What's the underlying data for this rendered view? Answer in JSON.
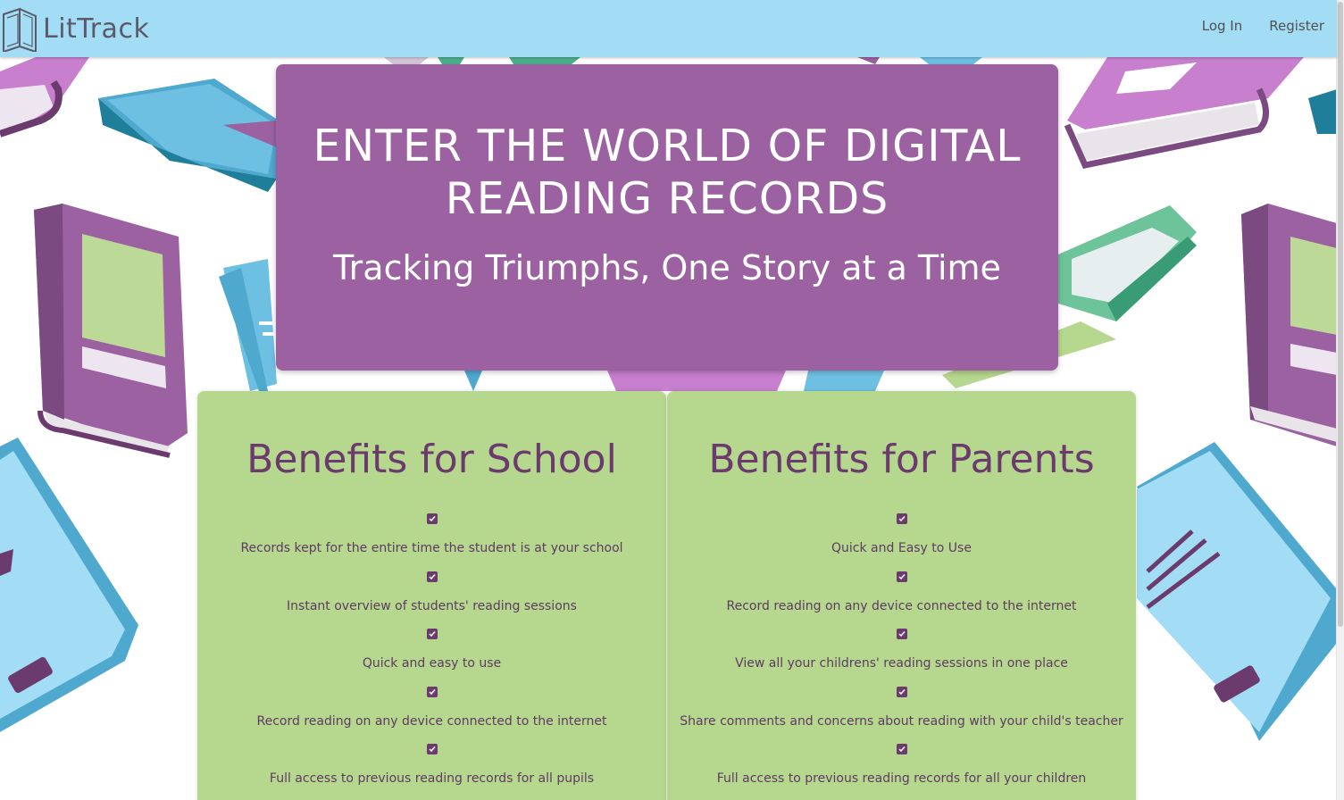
{
  "navbar": {
    "brand": "LitTrack",
    "brand_icon": "open-book-icon",
    "links": [
      {
        "label": "Log In"
      },
      {
        "label": "Register"
      }
    ],
    "background_color": "#a3dcf5"
  },
  "hero": {
    "title": "ENTER THE WORLD OF DIGITAL READING RECORDS",
    "subtitle": "Tracking Triumphs, One Story at a Time",
    "background_color": "#9b61a1"
  },
  "school_card": {
    "title": "Benefits for School",
    "items": [
      "Records kept for the entire time the student is at your school",
      "Instant overview of students' reading sessions",
      "Quick and easy to use",
      "Record reading on any device connected to the internet",
      "Full access to previous reading records for all pupils"
    ]
  },
  "parents_card": {
    "title": "Benefits for Parents",
    "items": [
      "Quick and Easy to Use",
      "Record reading on any device connected to the internet",
      "View all your childrens' reading sessions in one place",
      "Share comments and concerns about reading with your child's teacher",
      "Full access to previous reading records for all your children"
    ]
  },
  "theme": {
    "card_color": "#b5d78e",
    "accent_purple": "#6b3b6e"
  }
}
